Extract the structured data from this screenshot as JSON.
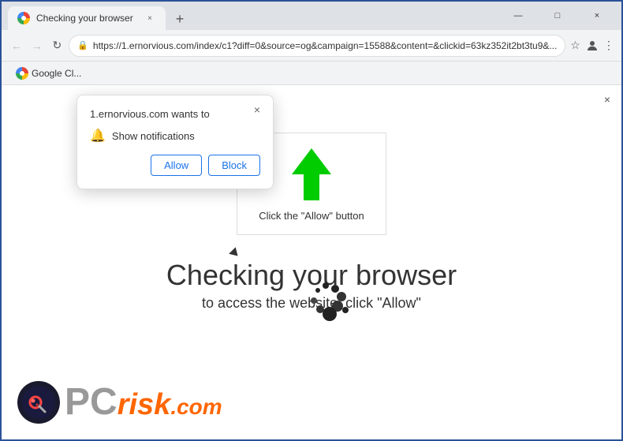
{
  "window": {
    "title": "Checking your browser",
    "tab_title": "Checking your browser",
    "url": "https://1.ernorvious.com/index/c1?diff=0&source=og&campaign=15588&content=&clickid=63kz352it2bt3tu9&...",
    "close_label": "×",
    "minimize_label": "—",
    "maximize_label": "□"
  },
  "nav": {
    "back_icon": "←",
    "forward_icon": "→",
    "reload_icon": "↻"
  },
  "bookmarks": {
    "item_label": "Google Cl..."
  },
  "popup": {
    "title": "1.ernorvious.com wants to",
    "close_icon": "×",
    "notification_label": "Show notifications",
    "allow_label": "Allow",
    "block_label": "Block"
  },
  "page": {
    "close_icon": "×",
    "instruction_text": "Click the \"Allow\" button",
    "checking_title": "Checking your browser",
    "checking_subtitle": "to access the website, click \"Allow\""
  },
  "pcrisk": {
    "pc_text": "PC",
    "risk_text": "risk",
    "dotcom_text": ".com"
  }
}
